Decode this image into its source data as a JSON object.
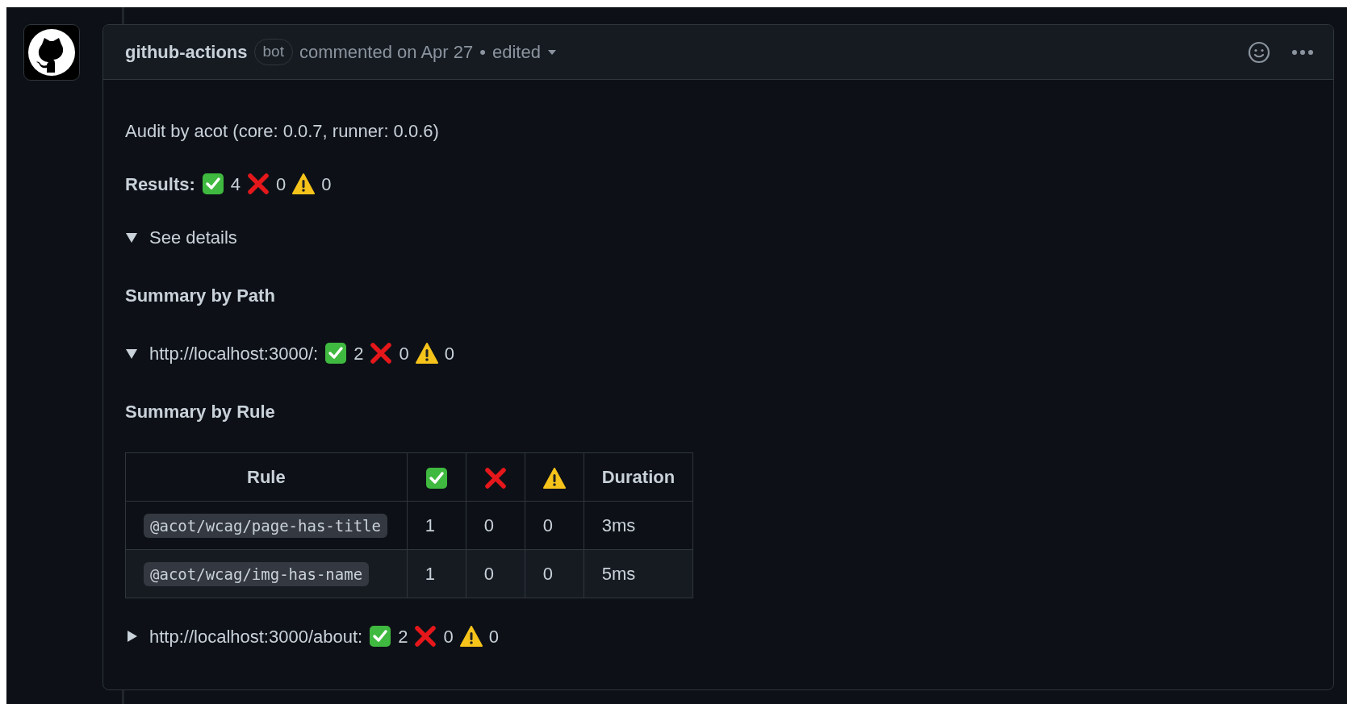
{
  "comment": {
    "author": "github-actions",
    "badge": "bot",
    "action": "commented on Apr 27",
    "separator": "•",
    "edited": "edited"
  },
  "blocks": [
    {
      "kind": "text",
      "text": "Audit by acot (core: 0.0.7, runner: 0.0.6)"
    },
    {
      "kind": "results",
      "label": "Results:",
      "counts": [
        {
          "kind": "pass",
          "value": "4"
        },
        {
          "kind": "fail",
          "value": "0"
        },
        {
          "kind": "warn",
          "value": "0"
        }
      ]
    },
    {
      "kind": "disclosure",
      "label": "See details",
      "expanded": true
    },
    {
      "kind": "heading",
      "text": "Summary by Path"
    },
    {
      "kind": "path",
      "label": "http://localhost:3000/:",
      "expanded": true,
      "counts": [
        {
          "kind": "pass",
          "value": "2"
        },
        {
          "kind": "fail",
          "value": "0"
        },
        {
          "kind": "warn",
          "value": "0"
        }
      ]
    },
    {
      "kind": "heading",
      "text": "Summary by Rule"
    },
    {
      "kind": "table",
      "columns": [
        {
          "kind": "text",
          "label": "Rule"
        },
        {
          "kind": "pass"
        },
        {
          "kind": "fail"
        },
        {
          "kind": "warn"
        },
        {
          "kind": "text",
          "label": "Duration"
        }
      ],
      "rows": [
        [
          "@acot/wcag/page-has-title",
          "1",
          "0",
          "0",
          "3ms"
        ],
        [
          "@acot/wcag/img-has-name",
          "1",
          "0",
          "0",
          "5ms"
        ]
      ]
    },
    {
      "kind": "path",
      "label": "http://localhost:3000/about:",
      "expanded": false,
      "counts": [
        {
          "kind": "pass",
          "value": "2"
        },
        {
          "kind": "fail",
          "value": "0"
        },
        {
          "kind": "warn",
          "value": "0"
        }
      ]
    }
  ]
}
